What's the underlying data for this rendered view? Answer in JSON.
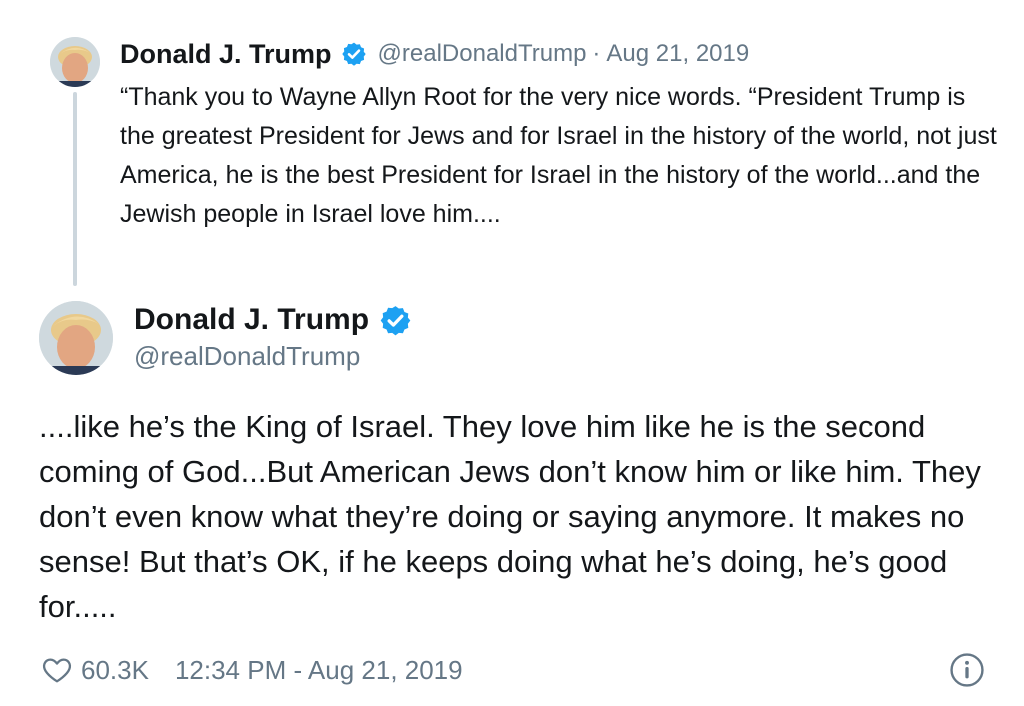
{
  "parent_tweet": {
    "author_name": "Donald J. Trump",
    "handle": "@realDonaldTrump",
    "separator": "·",
    "date": "Aug 21, 2019",
    "text": "“Thank you to Wayne Allyn Root for the very nice words. “President Trump is the greatest President for Jews and for Israel in the history of the world, not just America, he is the best President for Israel in the history of the world...and the Jewish people in Israel love him....",
    "avatar_icon": "profile-photo",
    "verified_icon": "verified-badge-icon"
  },
  "main_tweet": {
    "author_name": "Donald J. Trump",
    "handle": "@realDonaldTrump",
    "text": "....like he’s the King of Israel. They love him like he is the second coming of God...But American Jews don’t know him or like him. They don’t even know what they’re doing or saying anymore. It makes no sense! But that’s OK, if he keeps doing what he’s doing, he’s good for.....",
    "avatar_icon": "profile-photo",
    "verified_icon": "verified-badge-icon"
  },
  "footer": {
    "likes": "60.3K",
    "timestamp": "12:34 PM - Aug 21, 2019",
    "heart_icon": "heart-icon",
    "info_icon": "info-icon"
  },
  "colors": {
    "verified_blue": "#1da1f2",
    "text_primary": "#14171a",
    "text_secondary": "#657786",
    "thread_line": "#ccd6dd"
  }
}
